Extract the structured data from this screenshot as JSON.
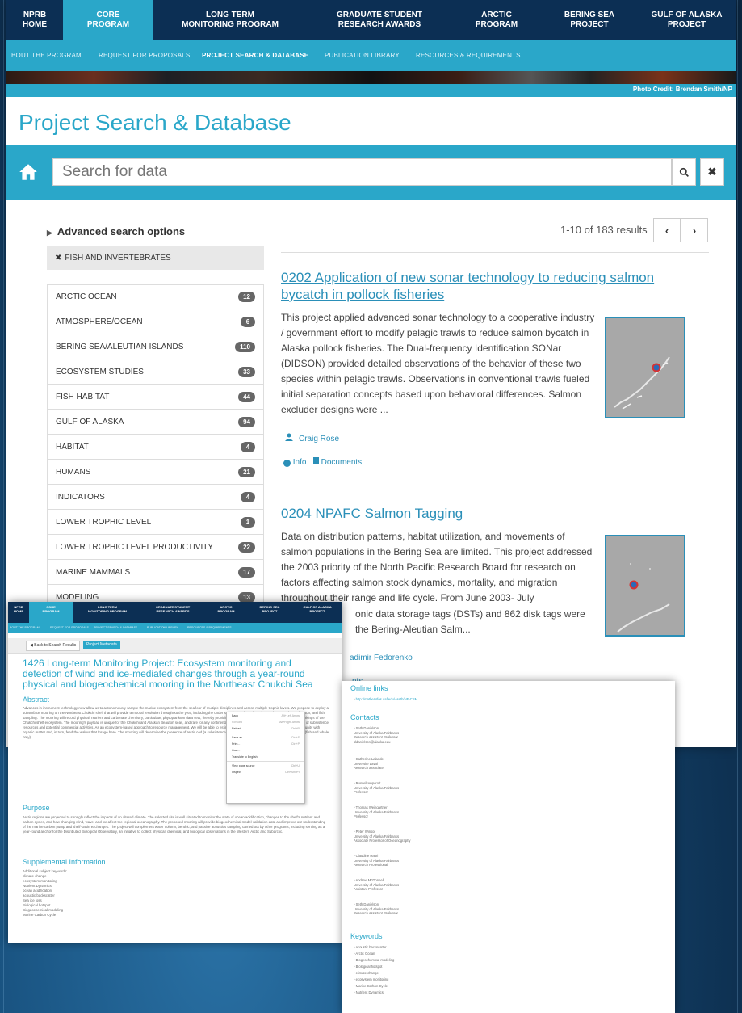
{
  "main": {
    "topnav": [
      {
        "label": "NPRB\nHOME"
      },
      {
        "label": "CORE\nPROGRAM"
      },
      {
        "label": "LONG TERM\nMONITORING PROGRAM"
      },
      {
        "label": "GRADUATE STUDENT\nRESEARCH AWARDS"
      },
      {
        "label": "ARCTIC\nPROGRAM"
      },
      {
        "label": "BERING SEA\nPROJECT"
      },
      {
        "label": "GULF OF ALASKA\nPROJECT"
      }
    ],
    "subnav": [
      "BOUT THE PROGRAM",
      "REQUEST FOR PROPOSALS",
      "PROJECT SEARCH & DATABASE",
      "PUBLICATION LIBRARY",
      "RESOURCES & REQUIREMENTS"
    ],
    "photo_credit": "Photo Credit: Brendan Smith/NP",
    "page_title": "Project Search & Database",
    "search": {
      "placeholder": "Search for data",
      "search_icon": "magnifier",
      "clear_icon": "x"
    },
    "advanced_label": "Advanced search options",
    "active_filter": "FISH AND INVERTEBRATES",
    "facets": [
      {
        "label": "ARCTIC OCEAN",
        "count": "12"
      },
      {
        "label": "ATMOSPHERE/OCEAN",
        "count": "6"
      },
      {
        "label": "BERING SEA/ALEUTIAN ISLANDS",
        "count": "110"
      },
      {
        "label": "ECOSYSTEM STUDIES",
        "count": "33"
      },
      {
        "label": "FISH HABITAT",
        "count": "44"
      },
      {
        "label": "GULF OF ALASKA",
        "count": "94"
      },
      {
        "label": "HABITAT",
        "count": "4"
      },
      {
        "label": "HUMANS",
        "count": "21"
      },
      {
        "label": "INDICATORS",
        "count": "4"
      },
      {
        "label": "LOWER TROPHIC LEVEL",
        "count": "1"
      },
      {
        "label": "LOWER TROPHIC LEVEL PRODUCTIVITY",
        "count": "22"
      },
      {
        "label": "MARINE MAMMALS",
        "count": "17"
      },
      {
        "label": "MODELING",
        "count": "13"
      }
    ],
    "result_count": "1-10 of 183 results",
    "results": [
      {
        "title": "0202 Application of new sonar technology to reducing salmon bycatch in pollock fisheries",
        "description": "This project applied advanced sonar technology to a cooperative industry / government effort to modify pelagic trawls to reduce salmon bycatch in Alaska pollock fisheries. The Dual-frequency Identification SONar (DIDSON) provided detailed observations of the behavior of these two species within pelagic trawls. Observations in conventional trawls fueled initial separation concepts based upon behavioral differences. Salmon excluder designs were ...",
        "author": "Craig Rose",
        "info_label": "Info",
        "documents_label": "Documents"
      },
      {
        "title": "0204 NPAFC Salmon Tagging",
        "description": "Data on distribution patterns, habitat utilization, and movements of salmon populations in the Bering Sea are limited. This project addressed the 2003 priority of the North Pacific Research Board for research on factors affecting salmon stock dynamics, mortality, and migration throughout their range and life cycle. From June 2003- July",
        "description_tail1": "onic data storage tags (DSTs) and 862 disk tags were",
        "description_tail2": "the Bering-Aleutian Salm...",
        "author": "adimir Fedorenko",
        "docs_fragment": "nts"
      }
    ]
  },
  "overlay1": {
    "back_button": "Back to Search Results",
    "metadata_button": "Project Metadata",
    "title": "1426 Long-term Monitoring Project: Ecosystem monitoring and detection of wind and ice-mediated changes through a year-round physical and biogeochemical mooring in the Northeast Chukchi Sea",
    "abstract_heading": "Abstract",
    "abstract_text": "Advances in instrument technology now allow us to autonomously sample the marine ecosystem from the seafloor of multiple disciplines and across multiple trophic levels. We propose to deploy a subsurface mooring on the Northeast Chukchi shelf that will provide temporal resolution throughout the year, including the under sampled and poorly understood seasonal, zooplankton, and fish sampling. The mooring will record physical, nutrient and carbonate chemistry, particulate, phytoplankton data sets, thereby providing an unprecedented view into the mechanistic workings of the Chukchi shelf ecosystem. The mooring's payload is unique for the Chukchi and Alaskan Beaufort seas, and rare for any continental shelf. The proposed project will aid management of subsistence resources and potential commercial activities. As an ecosystem-based approach to resource management, We will be able to estimate the particulate flux to apply the benthic community with organic matter and, in turn, feed the walrus that forage here. The mooring will determine the presence of arctic cod (a subsistence resource, marine mammal prey) and euphausiids (fish and whale prey).",
    "purpose_heading": "Purpose",
    "purpose_text": "Arctic regions are projected to strongly reflect the impacts of an altered climate. The selected site is well situated to monitor the state of ocean acidification, changes to the shelf's nutrient and carbon cycles, and how changing wind, wave, and ice affect the regional oceanography. The proposed mooring will provide biogeochemical model validation data and improve our understanding of the marine carbon pump and shelf-basin exchanges. The project will complement water column, benthic, and passive acoustics sampling carried out by other programs, including serving as a year-round anchor for the Distributed Biological Observatory, an initiative to collect physical, chemical, and biological observations in the Western Arctic and Subarctic.",
    "supplemental_heading": "Supplemental Information",
    "keywords_lines": [
      "Additional subject keywords:",
      "climate change",
      "ecosystem monitoring",
      "Nutrient Dynamics",
      "ocean acidification",
      "acoustic backscatter",
      "Sea ice loss",
      "Biological hotspot",
      "Biogeochemical modeling",
      "Marine Carbon Cycle"
    ],
    "context_menu": [
      {
        "label": "Back",
        "shortcut": "Alt+Left Arrow"
      },
      {
        "label": "Forward",
        "shortcut": "Alt+Right Arrow"
      },
      {
        "label": "Reload",
        "shortcut": "Ctrl+R"
      },
      {
        "label": "Save as...",
        "shortcut": "Ctrl+S"
      },
      {
        "label": "Print...",
        "shortcut": "Ctrl+P"
      },
      {
        "label": "Cast...",
        "shortcut": ""
      },
      {
        "label": "Translate to English",
        "shortcut": ""
      },
      {
        "label": "View page source",
        "shortcut": "Ctrl+U"
      },
      {
        "label": "Inspect",
        "shortcut": "Ctrl+Shift+I"
      }
    ]
  },
  "overlay2": {
    "online_heading": "Online links",
    "online_link": "http://mather.sfos.uaf.edu/~seth/NE-CSM",
    "contacts_heading": "Contacts",
    "contacts": [
      "Seth Danielson\nUniversity of Alaska Fairbanks\nResearch Assistant Professor\nsldanielson@alaska.edu",
      "Catherine Lalande\nUniversite Laval\nResearch associate",
      "Russell Hopcroft\nUniversity of Alaska Fairbanks\nProfessor",
      "Thomas Weingartner\nUniversity of Alaska Fairbanks\nProfessor",
      "Peter Winsor\nUniversity of Alaska Fairbanks\nAssociate Professor of Oceanography",
      "Claudine Hauri\nUniversity of Alaska Fairbanks\nResearch Professional",
      "Andrew McDonnell\nUniversity of Alaska Fairbanks\nAssistant Professor",
      "Seth Danielson\nUniversity of Alaska Fairbanks\nResearch Assistant Professor"
    ],
    "keywords_heading": "Keywords",
    "keywords": [
      "acoustic backscatter",
      "Arctic Ocean",
      "Biogeochemical modeling",
      "Biological hotspot",
      "climate change",
      "ecosystem monitoring",
      "Marine Carbon Cycle",
      "Nutrient Dynamics"
    ]
  }
}
